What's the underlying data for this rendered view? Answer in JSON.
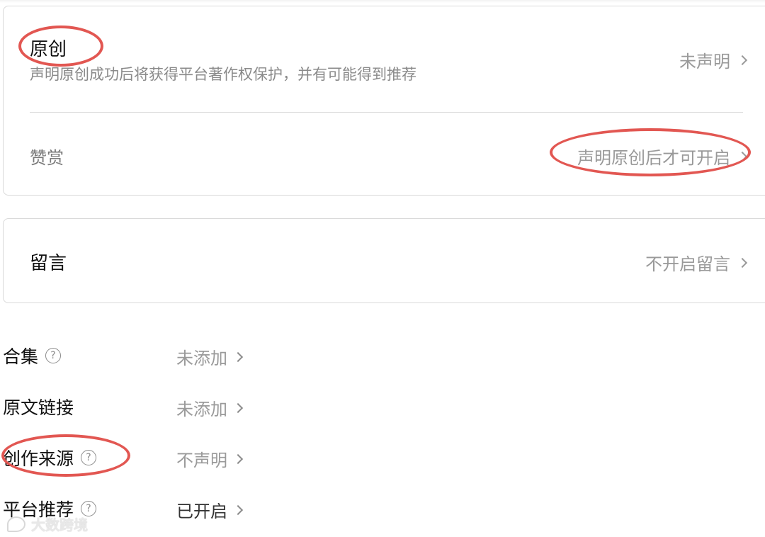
{
  "original_section": {
    "title": "原创",
    "description": "声明原创成功后将获得平台著作权保护，并有可能得到推荐",
    "value": "未声明"
  },
  "reward_section": {
    "title": "赞赏",
    "value": "声明原创后才可开启"
  },
  "comment_section": {
    "title": "留言",
    "value": "不开启留言"
  },
  "settings_list": [
    {
      "label": "合集",
      "has_help": true,
      "value": "未添加"
    },
    {
      "label": "原文链接",
      "has_help": false,
      "value": "未添加"
    },
    {
      "label": "创作来源",
      "has_help": true,
      "value": "不声明"
    },
    {
      "label": "平台推荐",
      "has_help": true,
      "value": "已开启"
    }
  ],
  "help_icon_glyph": "?",
  "watermark": "大数跨境",
  "colors": {
    "annotation_red": "#e25752",
    "muted_text": "#999999",
    "border": "#d9d9d9"
  },
  "icons": {
    "chevron": "chevron-right-icon",
    "help": "question-circle-icon"
  }
}
